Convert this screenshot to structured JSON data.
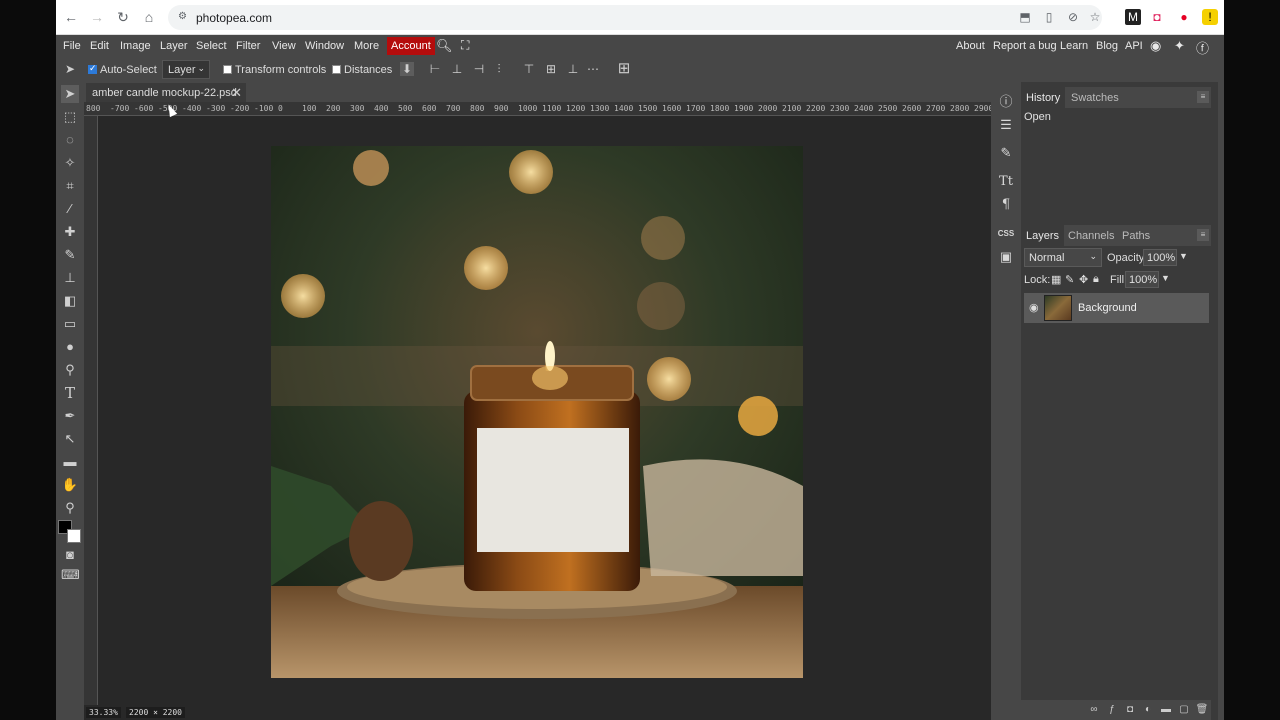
{
  "browser": {
    "url": "photopea.com"
  },
  "menu": {
    "items": [
      "File",
      "Edit",
      "Image",
      "Layer",
      "Select",
      "Filter",
      "View",
      "Window",
      "More"
    ],
    "account": "Account",
    "right_links": [
      "About",
      "Report a bug",
      "Learn",
      "Blog",
      "API"
    ]
  },
  "options": {
    "auto_select": "Auto-Select",
    "layer_select": "Layer",
    "transform_controls": "Transform controls",
    "distances": "Distances"
  },
  "document": {
    "tab_title": "amber candle mockup-22.psd",
    "zoom": "33.33%",
    "size": "2200 × 2200"
  },
  "ruler": {
    "labels": [
      "800",
      "-700",
      "-600",
      "-500",
      "-400",
      "-300",
      "-200",
      "-100",
      "0",
      "100",
      "200",
      "300",
      "400",
      "500",
      "600",
      "700",
      "800",
      "900",
      "1000",
      "1100",
      "1200",
      "1300",
      "1400",
      "1500",
      "1600",
      "1700",
      "1800",
      "1900",
      "2000",
      "2100",
      "2200",
      "2300",
      "2400",
      "2500",
      "2600",
      "2700",
      "2800",
      "2900"
    ]
  },
  "history": {
    "tabs": [
      "History",
      "Swatches"
    ],
    "items": [
      "Open"
    ]
  },
  "layers": {
    "tabs": [
      "Layers",
      "Channels",
      "Paths"
    ],
    "blend_mode": "Normal",
    "opacity_label": "Opacity:",
    "opacity": "100%",
    "lock_label": "Lock:",
    "fill_label": "Fill:",
    "fill": "100%",
    "items": [
      {
        "name": "Background",
        "visible": true
      }
    ]
  },
  "right_strip": {
    "css_label": "CSS"
  },
  "colors": {
    "accent": "#b40c0c",
    "panel": "#474747",
    "canvas": "#282828"
  }
}
